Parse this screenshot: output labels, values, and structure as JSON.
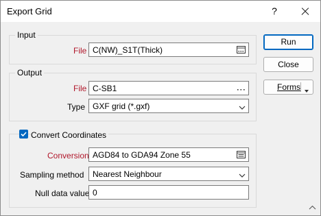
{
  "window": {
    "title": "Export Grid",
    "help_glyph": "?",
    "icons": {
      "help": "question-mark-icon",
      "close": "close-icon"
    }
  },
  "input_group": {
    "legend": "Input",
    "file_label": "File",
    "file_value": "C(NW)_S1T(Thick)",
    "file_icon": "browse-list-icon"
  },
  "output_group": {
    "legend": "Output",
    "file_label": "File",
    "file_value": "C-SB1",
    "file_icon": "ellipsis-icon",
    "type_label": "Type",
    "type_value": "GXF grid (*.gxf)"
  },
  "convert_group": {
    "checkbox_label": "Convert Coordinates",
    "checked": true,
    "conversion_label": "Conversion",
    "conversion_value": "AGD84 to GDA94 Zone 55",
    "conversion_icon": "list-picker-icon",
    "sampling_label": "Sampling method",
    "sampling_value": "Nearest Neighbour",
    "null_label": "Null data value",
    "null_value": "0"
  },
  "buttons": {
    "run": "Run",
    "close": "Close",
    "forms": "Forms"
  },
  "colors": {
    "required_label": "#b0162a",
    "accent": "#0067c0"
  }
}
